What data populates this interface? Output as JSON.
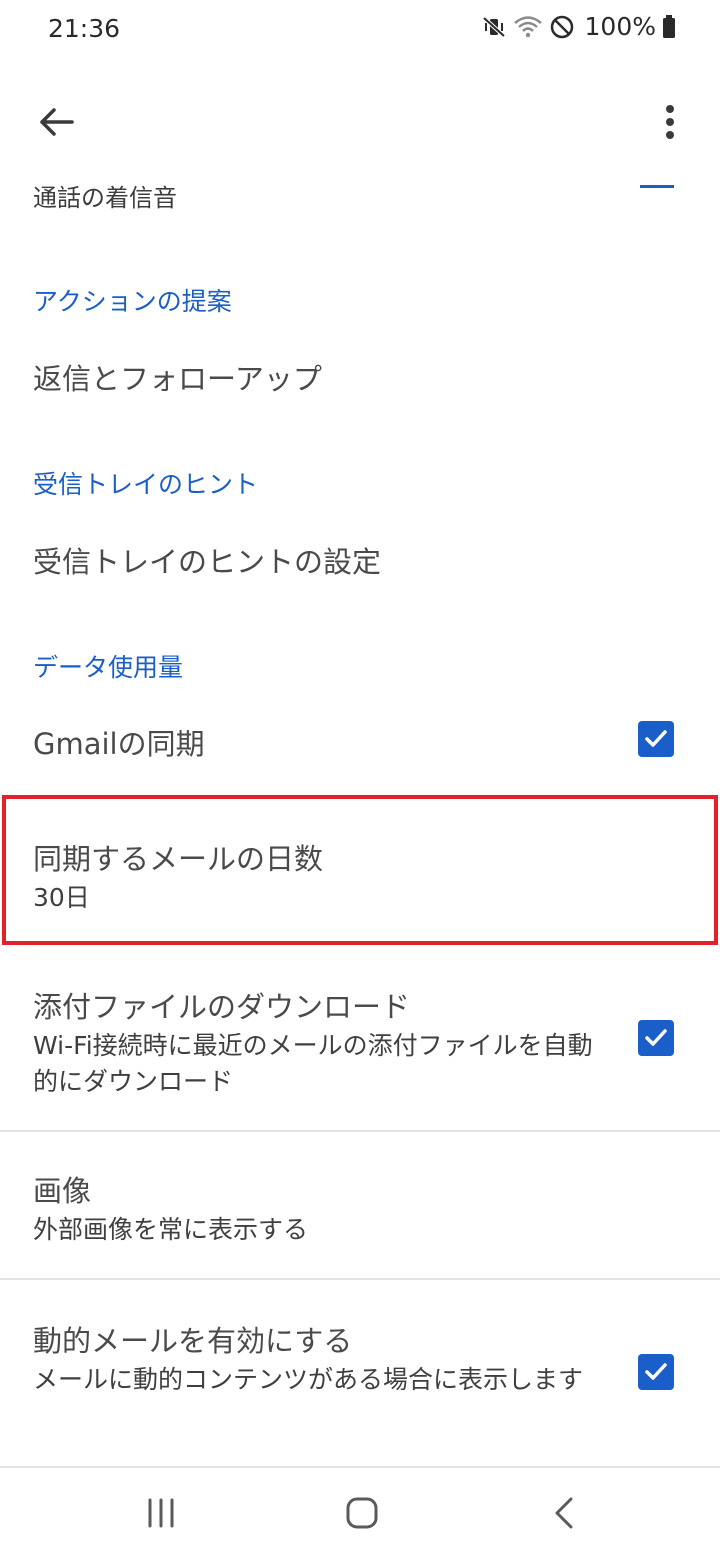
{
  "status_bar": {
    "time": "21:36",
    "battery": "100%",
    "icons": [
      "vibrate-icon",
      "wifi-icon",
      "do-not-disturb-icon",
      "battery-icon"
    ]
  },
  "app_bar": {
    "icons": [
      "back-arrow-icon",
      "more-vert-icon"
    ]
  },
  "settings": {
    "partial_item": {
      "title": "通話の着信音"
    },
    "actions_section": {
      "header": "アクションの提案",
      "item": {
        "title": "返信とフォローアップ"
      }
    },
    "inbox_tips_section": {
      "header": "受信トレイのヒント",
      "item": {
        "title": "受信トレイのヒントの設定"
      }
    },
    "data_usage_section": {
      "header": "データ使用量",
      "gmail_sync": {
        "title": "Gmailの同期",
        "checked": true
      },
      "sync_days": {
        "title": "同期するメールの日数",
        "value": "30日"
      },
      "attachments": {
        "title": "添付ファイルのダウンロード",
        "subtitle": "Wi-Fi接続時に最近のメールの添付ファイルを自動的にダウンロード",
        "checked": true
      },
      "images": {
        "title": "画像",
        "subtitle": "外部画像を常に表示する"
      },
      "dynamic_email": {
        "title": "動的メールを有効にする",
        "subtitle": "メールに動的コンテンツがある場合に表示します",
        "checked": true
      }
    }
  },
  "nav_bar": {
    "icons": [
      "recent-apps-icon",
      "home-icon",
      "back-icon"
    ]
  },
  "colors": {
    "accent": "#1a5fc9",
    "highlight_border": "#e2212b",
    "divider": "#e3e3e3"
  }
}
